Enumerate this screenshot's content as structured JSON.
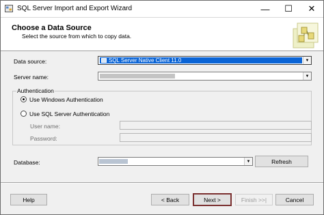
{
  "window": {
    "title": "SQL Server Import and Export Wizard",
    "minimize_glyph": "—",
    "maximize_glyph": "☐",
    "close_glyph": "✕"
  },
  "header": {
    "title": "Choose a Data Source",
    "subtitle": "Select the source from which to copy data."
  },
  "form": {
    "data_source_label": "Data source:",
    "data_source_value": "SQL Server Native Client 11.0",
    "server_name_label": "Server name:",
    "authentication": {
      "group_label": "Authentication",
      "windows_auth_label": "Use Windows Authentication",
      "sql_auth_label": "Use SQL Server Authentication",
      "selected": "windows",
      "user_name_label": "User name:",
      "password_label": "Password:"
    },
    "database_label": "Database:",
    "refresh_label": "Refresh"
  },
  "footer": {
    "help_label": "Help",
    "back_label": "< Back",
    "next_label": "Next >",
    "finish_label": "Finish >>|",
    "cancel_label": "Cancel"
  },
  "icons": {
    "app": "wizard-app-icon",
    "dropdown": "chevron-down-icon",
    "header_graphic": "data-transfer-graphic"
  },
  "colors": {
    "selection": "#0a64d6",
    "default_button_border": "#7a2f2f"
  }
}
